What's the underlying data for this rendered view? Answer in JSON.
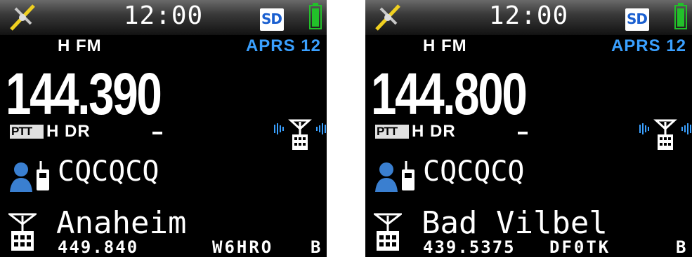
{
  "colors": {
    "background": "#000000",
    "accent_aprs": "#3aa0ff",
    "battery": "#22c02a",
    "sd_blue": "#1a5fd0"
  },
  "icons": {
    "gps": "gps-satellite-icon",
    "sd": "sd-card-icon",
    "battery": "battery-icon",
    "signal": "repeater-signal-icon",
    "cq": "cq-operator-icon",
    "repeater": "repeater-tower-icon"
  },
  "screens": [
    {
      "clock": "12:00",
      "sd": "SD",
      "mode": "H FM",
      "aprs": "APRS 12",
      "frequency": "144.390",
      "ptt": "PTT",
      "power_mode": "H DR",
      "offset": "–",
      "callsign_target": "CQCQCQ",
      "repeater_name": "Anaheim",
      "repeater_freq": "449.840",
      "repeater_call": "W6HRO",
      "repeater_module": "B"
    },
    {
      "clock": "12:00",
      "sd": "SD",
      "mode": "H FM",
      "aprs": "APRS 12",
      "frequency": "144.800",
      "ptt": "PTT",
      "power_mode": "H DR",
      "offset": "–",
      "callsign_target": "CQCQCQ",
      "repeater_name": "Bad Vilbel",
      "repeater_freq": "439.5375",
      "repeater_call": "DF0TK",
      "repeater_module": "B"
    }
  ]
}
